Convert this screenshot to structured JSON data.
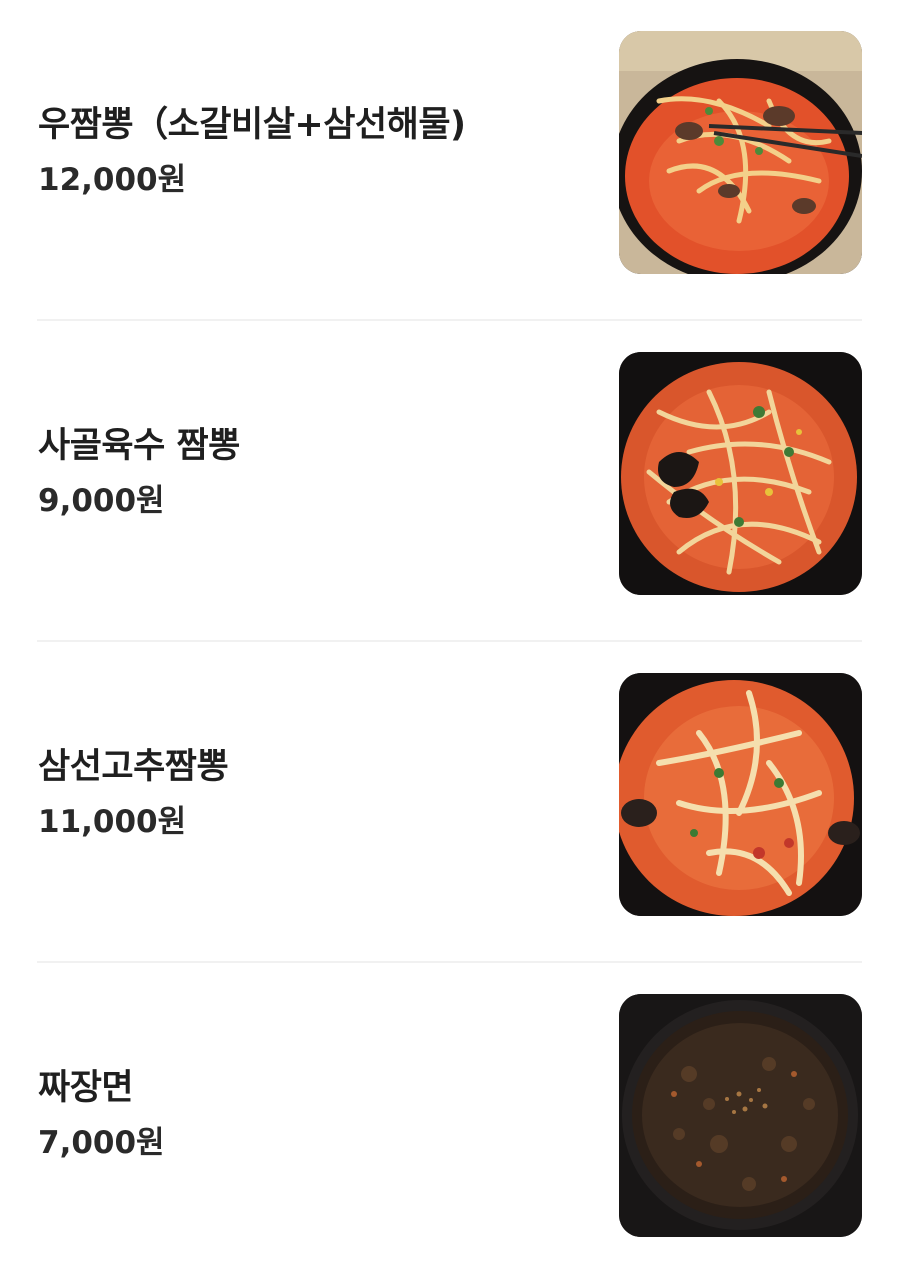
{
  "menu": {
    "items": [
      {
        "name": "우짬뽕（소갈비살+삼선해물)",
        "price": "12,000원",
        "photo_icon": "jjamppong-bowl-photo"
      },
      {
        "name": "사골육수 짬뽕",
        "price": "9,000원",
        "photo_icon": "jjamppong-bowl-photo"
      },
      {
        "name": "삼선고추짬뽕",
        "price": "11,000원",
        "photo_icon": "jjamppong-bowl-photo"
      },
      {
        "name": "짜장면",
        "price": "7,000원",
        "photo_icon": "jajangmyeon-bowl-photo"
      }
    ]
  },
  "colors": {
    "background": "#ffffff",
    "text": "#1f1f1f",
    "divider": "#f1f1f1",
    "soup_red": "#e2512a",
    "jajang_brown": "#2b2018"
  }
}
